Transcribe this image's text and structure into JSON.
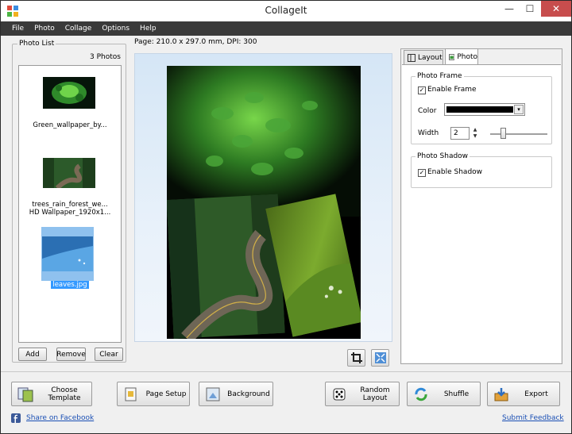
{
  "window": {
    "title": "CollageIt",
    "minimize": "—",
    "maximize": "☐",
    "close": "✕"
  },
  "menu": [
    "File",
    "Photo",
    "Collage",
    "Options",
    "Help"
  ],
  "photo_list": {
    "group_title": "Photo List",
    "count": "3 Photos",
    "items": [
      {
        "label": "Green_wallpaper_by..."
      },
      {
        "label": "trees_rain_forest_we...",
        "label2": "HD Wallpaper_1920x1..."
      },
      {
        "label": "leaves.jpg"
      }
    ],
    "add": "Add",
    "remove": "Remove",
    "clear": "Clear"
  },
  "page_info": "Page: 210.0 x 297.0 mm, DPI: 300",
  "props": {
    "tabs": [
      "Layout",
      "Photo"
    ],
    "frame_title": "Photo Frame",
    "enable_frame": "Enable Frame",
    "color_label": "Color",
    "color_value": "#000000",
    "width_label": "Width",
    "width_value": "2",
    "shadow_title": "Photo Shadow",
    "enable_shadow": "Enable Shadow"
  },
  "buttons": {
    "choose_template": "Choose Template",
    "page_setup": "Page Setup",
    "background": "Background",
    "random_layout": "Random Layout",
    "shuffle": "Shuffle",
    "export": "Export"
  },
  "links": {
    "facebook": "Share on Facebook",
    "feedback": "Submit Feedback"
  }
}
